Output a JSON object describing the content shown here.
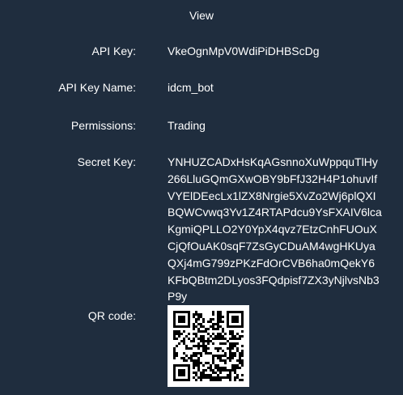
{
  "dialog": {
    "title": "View"
  },
  "fields": {
    "api_key": {
      "label": "API Key:",
      "value": "VkeOgnMpV0WdiPiDHBScDg"
    },
    "api_key_name": {
      "label": "API Key Name:",
      "value": "idcm_bot"
    },
    "permissions": {
      "label": "Permissions:",
      "value": "Trading"
    },
    "secret_key": {
      "label": "Secret Key:",
      "value": "YNHUZCADxHsKqAGsnnoXuWppquTlHy266LluGQmGXwOBY9bFfJ32H4P1ohuvIfVYElDEecLx1lZX8Nrgie5XvZo2Wj6plQXIBQWCvwq3Yv1Z4RTAPdcu9YsFXAIV6lcaKgmiQPLLO2Y0YpX4qvz7EtzCnhFUOuXCjQfOuAK0sqF7ZsGyCDuAM4wgHKUyaQXj4mG799zPKzFdOrCVB6ha0mQekY6KFbQBtm2DLyos3FQdpisf7ZX3yNjlvsNb3P9y"
    },
    "qr_code": {
      "label": "QR code:"
    }
  },
  "colors": {
    "background": "#1f2d3e",
    "text": "#ffffff"
  }
}
